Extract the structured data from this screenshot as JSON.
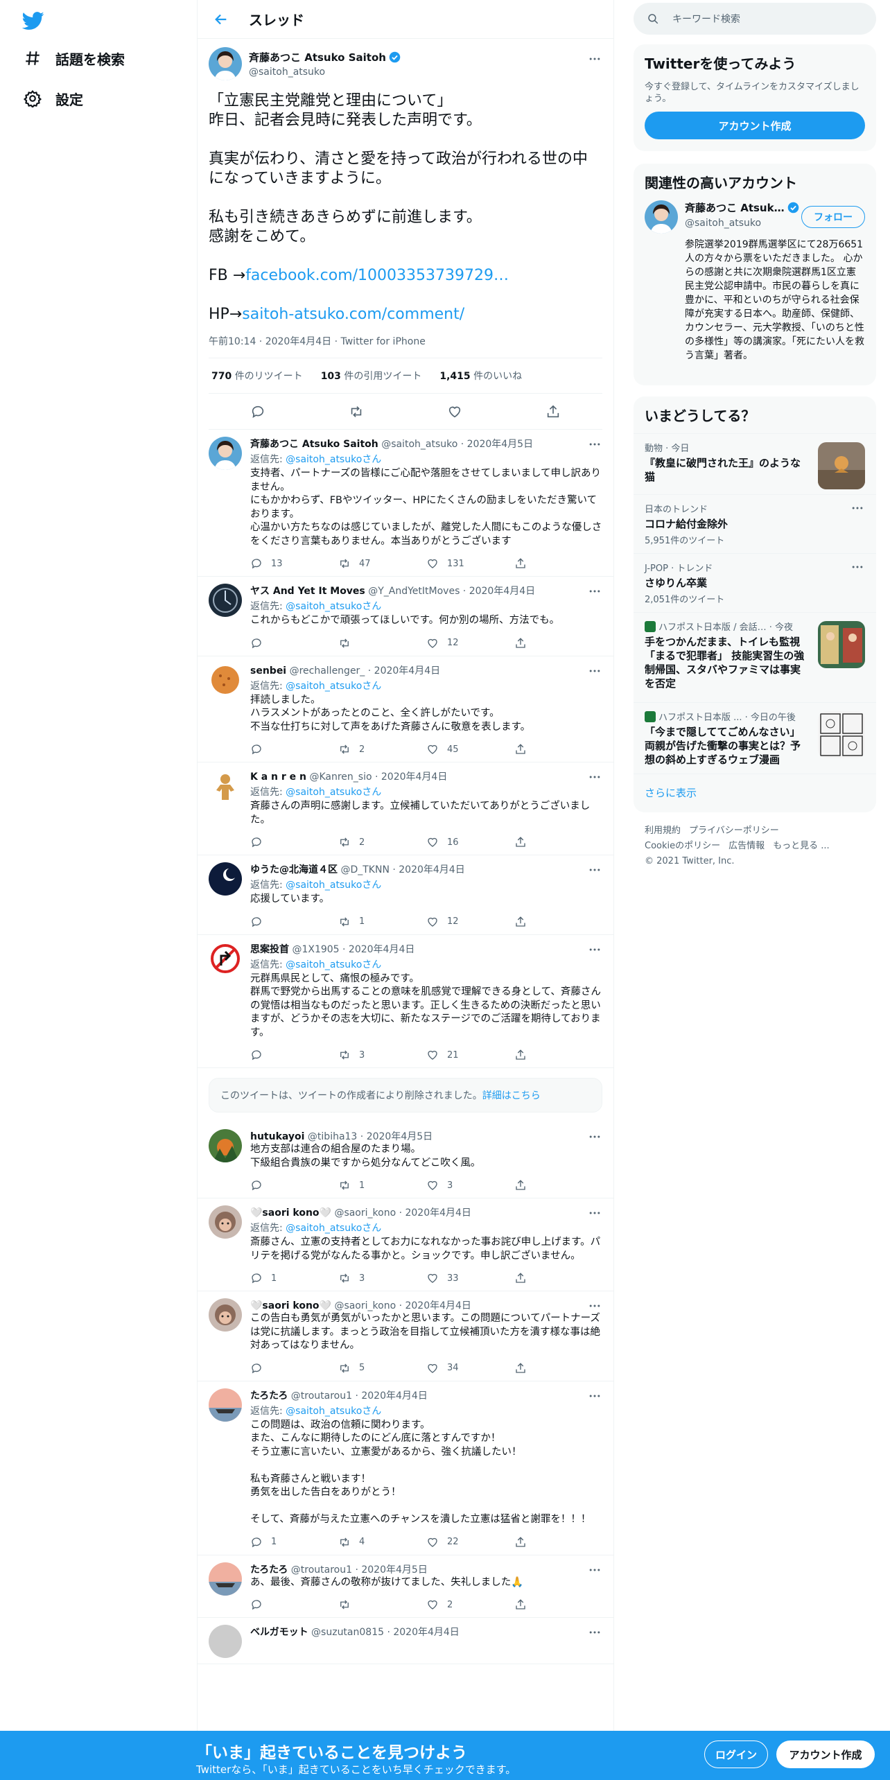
{
  "nav": {
    "explore_label": "話題を検索",
    "settings_label": "設定"
  },
  "header": {
    "title": "スレッド"
  },
  "main_tweet": {
    "name": "斉藤あつこ Atsuko Saitoh",
    "handle": "@saitoh_atsuko",
    "text": "「立憲民主党離党と理由について」\n昨日、記者会見時に発表した声明です。\n\n真実が伝わり、清さと愛を持って政治が行われる世の中になっていきますように。\n\n私も引き続きあきらめずに前進します。\n感謝をこめて。\n\n",
    "fb_prefix": "FB →",
    "fb_link": "facebook.com/10003353739729…",
    "hp_prefix": "HP→",
    "hp_link": "saitoh-atsuko.com/comment/",
    "meta": "午前10:14 · 2020年4月4日 · Twitter for iPhone",
    "retweets": "770",
    "retweets_label": "件のリツイート",
    "quotes": "103",
    "quotes_label": "件の引用ツイート",
    "likes": "1,415",
    "likes_label": "件のいいね"
  },
  "replies": [
    {
      "name": "斉藤あつこ Atsuko Saitoh",
      "handle": "@saitoh_atsuko · 2020年4月5日",
      "reply_to": "返信先: ",
      "reply_to_handle": "@saitoh_atsukoさん",
      "text": "支持者、パートナーズの皆様にご心配や落胆をさせてしまいまして申し訳ありません。\nにもかかわらず、FBやツイッター、HPにたくさんの励ましをいただき驚いております。\n心温かい方たちなのは感じていましたが、離党した人間にもこのような優しさをくださり言葉もありません。本当ありがとうございます",
      "replies": "13",
      "rts": "47",
      "likes": "131"
    },
    {
      "name": "ヤス And Yet It Moves",
      "handle": "@Y_AndYetItMoves · 2020年4月4日",
      "reply_to": "返信先: ",
      "reply_to_handle": "@saitoh_atsukoさん",
      "text": "これからもどこかで頑張ってほしいです。何か別の場所、方法でも。",
      "replies": "",
      "rts": "",
      "likes": "12"
    },
    {
      "name": "senbei",
      "handle": "@rechallenger_ · 2020年4月4日",
      "reply_to": "返信先: ",
      "reply_to_handle": "@saitoh_atsukoさん",
      "text": "拝読しました。\nハラスメントがあったとのこと、全く許しがたいです。\n不当な仕打ちに対して声をあげた斉藤さんに敬意を表します。",
      "replies": "",
      "rts": "2",
      "likes": "45"
    },
    {
      "name": "K a n r e n",
      "handle": "@Kanren_sio · 2020年4月4日",
      "reply_to": "返信先: ",
      "reply_to_handle": "@saitoh_atsukoさん",
      "text": "斉藤さんの声明に感謝します。立候補していただいてありがとうございました。",
      "replies": "",
      "rts": "2",
      "likes": "16"
    },
    {
      "name": "ゆうた@北海道４区",
      "handle": "@D_TKNN · 2020年4月4日",
      "reply_to": "返信先: ",
      "reply_to_handle": "@saitoh_atsukoさん",
      "text": "応援しています。",
      "replies": "",
      "rts": "1",
      "likes": "12"
    },
    {
      "name": "思案投首",
      "handle": "@1X1905 · 2020年4月4日",
      "reply_to": "返信先: ",
      "reply_to_handle": "@saitoh_atsukoさん",
      "text": "元群馬県民として、痛恨の極みです。\n群馬で野党から出馬することの意味を肌感覚で理解できる身として、斉藤さんの覚悟は相当なものだったと思います。正しく生きるための決断だったと思いますが、どうかその志を大切に、新たなステージでのご活躍を期待しております。",
      "replies": "",
      "rts": "3",
      "likes": "21"
    }
  ],
  "deleted_notice": {
    "text": "このツイートは、ツイートの作成者により削除されました。",
    "link": "詳細はこちら"
  },
  "replies2": [
    {
      "name": "hutukayoi",
      "handle": "@tibiha13 · 2020年4月5日",
      "reply_to": "",
      "reply_to_handle": "",
      "text": "地方支部は連合の組合屋のたまり場。\n下級組合貴族の巣ですから処分なんてどこ吹く風。",
      "replies": "",
      "rts": "1",
      "likes": "3"
    },
    {
      "name": "🤍saori kono🤍",
      "handle": "@saori_kono · 2020年4月4日",
      "reply_to": "返信先: ",
      "reply_to_handle": "@saitoh_atsukoさん",
      "text": "斎藤さん、立憲の支持者としてお力になれなかった事お詫び申し上げます。パリテを掲げる党がなんたる事かと。ショックです。申し訳ございません。",
      "replies": "1",
      "rts": "3",
      "likes": "33"
    },
    {
      "name": "🤍saori kono🤍",
      "handle": "@saori_kono · 2020年4月4日",
      "reply_to": "",
      "reply_to_handle": "",
      "text": "この告白も勇気が勇気がいったかと思います。この問題についてパートナーズは党に抗議します。まっとう政治を目指して立候補頂いた方を潰す様な事は絶対あってはなりません。",
      "replies": "",
      "rts": "5",
      "likes": "34"
    },
    {
      "name": "たろたろ",
      "handle": "@troutarou1 · 2020年4月4日",
      "reply_to": "返信先: ",
      "reply_to_handle": "@saitoh_atsukoさん",
      "text": "この問題は、政治の信頼に関わります。\nまた、こんなに期待したのにどん底に落とすんですか！\nそう立憲に言いたい、立憲愛があるから、強く抗議したい！\n\n私も斉藤さんと戦います！\n勇気を出した告白をありがとう！\n\nそして、斉藤が与えた立憲へのチャンスを潰した立憲は猛省と謝罪を！！！",
      "replies": "1",
      "rts": "4",
      "likes": "22"
    },
    {
      "name": "たろたろ",
      "handle": "@troutarou1 · 2020年4月5日",
      "reply_to": "",
      "reply_to_handle": "",
      "text": "あ、最後、斉藤さんの敬称が抜けてました、失礼しました🙏",
      "replies": "",
      "rts": "",
      "likes": "2"
    },
    {
      "name": "ベルガモット",
      "handle": "@suzutan0815 · 2020年4月4日",
      "reply_to": "",
      "reply_to_handle": "",
      "text": "",
      "replies": "",
      "rts": "",
      "likes": ""
    }
  ],
  "search": {
    "placeholder": "キーワード検索"
  },
  "join": {
    "title": "Twitterを使ってみよう",
    "subtitle": "今すぐ登録して、タイムラインをカスタマイズしましょう。",
    "button": "アカウント作成"
  },
  "related": {
    "title": "関連性の高いアカウント",
    "name": "斉藤あつこ Atsuk…",
    "handle": "@saitoh_atsuko",
    "follow": "フォロー",
    "bio": "参院選挙2019群馬選挙区にて28万6651人の方々から票をいただきました。 心からの感謝と共に次期衆院選群馬1区立憲民主党公認申請中。市民の暮らしを真に豊かに、平和といのちが守られる社会保障が充実する日本へ。助産師、保健師、カウンセラー、元大学教授、「いのちと性の多様性」等の講演家。「死にたい人を救う言葉」著者。"
  },
  "trends": {
    "title": "いまどうしてる？",
    "items": [
      {
        "category": "動物 · 今日",
        "title": "『教皇に破門された王』のような猫",
        "count": ""
      },
      {
        "category": "日本のトレンド",
        "title": "コロナ給付金除外",
        "count": "5,951件のツイート"
      },
      {
        "category": "J-POP · トレンド",
        "title": "さゆりん卒業",
        "count": "2,051件のツイート"
      },
      {
        "category": "ハフポスト日本版 / 会話… · 今夜",
        "title": "手をつかんだまま、トイレも監視「まるで犯罪者」 技能実習生の強制帰国、スタバやファミマは事実を否定",
        "count": ""
      },
      {
        "category": "ハフポスト日本版 ... · 今日の午後",
        "title": "「今まで隠しててごめんなさい」両親が告げた衝撃の事実とは？予想の斜め上すぎるウェブ漫画",
        "count": ""
      }
    ],
    "show_more": "さらに表示"
  },
  "footer": {
    "terms": "利用規約",
    "privacy": "プライバシーポリシー",
    "cookie": "Cookieのポリシー",
    "ads": "広告情報",
    "more": "もっと見る ...",
    "copyright": "© 2021 Twitter, Inc."
  },
  "bottom": {
    "title": "「いま」起きていることを見つけよう",
    "subtitle": "Twitterなら、「いま」起きていることをいち早くチェックできます。",
    "login": "ログイン",
    "signup": "アカウント作成"
  },
  "colors": {
    "accent": "#1d9bf0",
    "text": "#0f1419",
    "muted": "#536471"
  }
}
